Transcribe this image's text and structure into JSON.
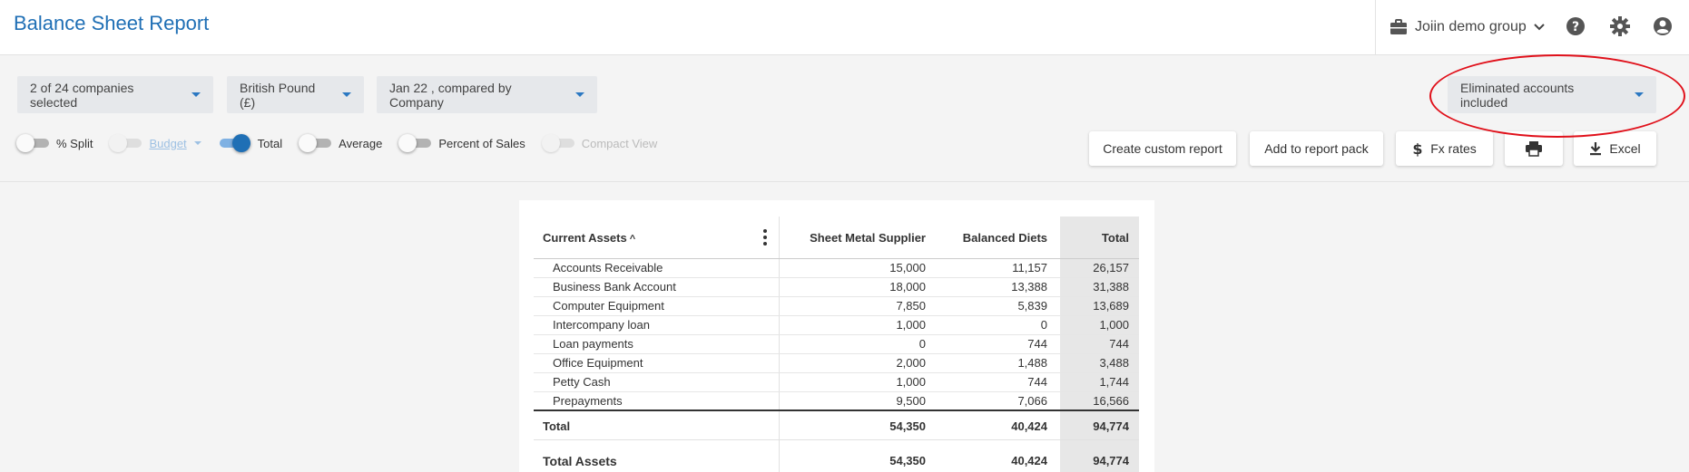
{
  "app": {
    "title": "Balance Sheet Report"
  },
  "topbar": {
    "group_label": "Joiin demo group"
  },
  "filters": {
    "companies": "2 of 24 companies selected",
    "currency": "British Pound (£)",
    "period": "Jan 22 , compared by Company",
    "eliminated": "Eliminated accounts included"
  },
  "toggles": {
    "split": {
      "label": "% Split",
      "on": false
    },
    "budget": {
      "label": "Budget",
      "on": false,
      "disabled": true
    },
    "total": {
      "label": "Total",
      "on": true
    },
    "average": {
      "label": "Average",
      "on": false
    },
    "percent_sales": {
      "label": "Percent of Sales",
      "on": false
    },
    "compact": {
      "label": "Compact View",
      "on": false,
      "disabled": true
    }
  },
  "actions": {
    "custom_report": "Create custom report",
    "report_pack": "Add to report pack",
    "fx_rates": "Fx rates",
    "excel": "Excel"
  },
  "table": {
    "section_title": "Current Assets",
    "columns": [
      "Sheet Metal Supplier",
      "Balanced Diets",
      "Total"
    ],
    "rows": [
      {
        "label": "Accounts Receivable",
        "v1": "15,000",
        "v2": "11,157",
        "v3": "26,157"
      },
      {
        "label": "Business Bank Account",
        "v1": "18,000",
        "v2": "13,388",
        "v3": "31,388"
      },
      {
        "label": "Computer Equipment",
        "v1": "7,850",
        "v2": "5,839",
        "v3": "13,689"
      },
      {
        "label": "Intercompany loan",
        "v1": "1,000",
        "v2": "0",
        "v3": "1,000"
      },
      {
        "label": "Loan payments",
        "v1": "0",
        "v2": "744",
        "v3": "744"
      },
      {
        "label": "Office Equipment",
        "v1": "2,000",
        "v2": "1,488",
        "v3": "3,488"
      },
      {
        "label": "Petty Cash",
        "v1": "1,000",
        "v2": "744",
        "v3": "1,744"
      },
      {
        "label": "Prepayments",
        "v1": "9,500",
        "v2": "7,066",
        "v3": "16,566"
      }
    ],
    "total": {
      "label": "Total",
      "v1": "54,350",
      "v2": "40,424",
      "v3": "94,774"
    },
    "total_assets": {
      "label": "Total Assets",
      "v1": "54,350",
      "v2": "40,424",
      "v3": "94,774"
    }
  },
  "colors": {
    "brand": "#1f6fb5",
    "highlight": "#e0101a"
  }
}
